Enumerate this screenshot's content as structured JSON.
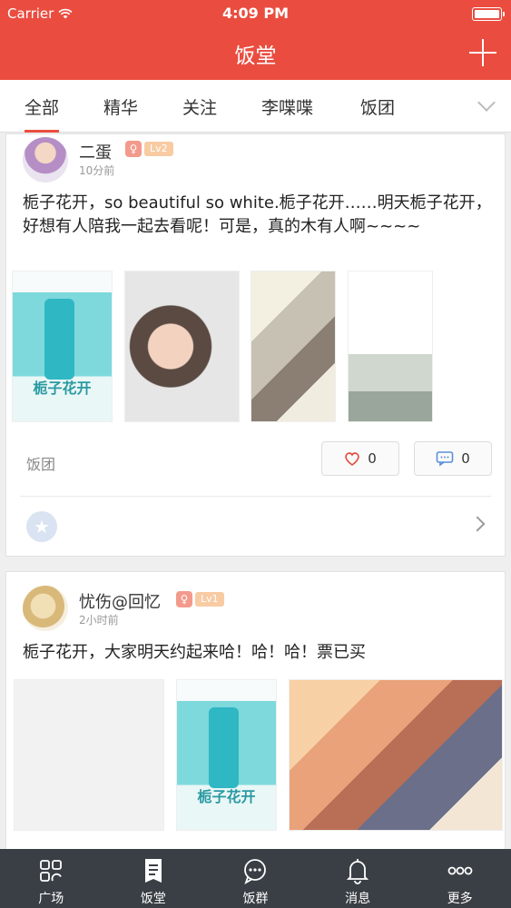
{
  "status_bar": {
    "carrier": "Carrier",
    "time": "4:09 PM"
  },
  "nav": {
    "title": "饭堂"
  },
  "tabs": [
    {
      "label": "全部",
      "active": true
    },
    {
      "label": "精华"
    },
    {
      "label": "关注"
    },
    {
      "label": "李喋喋"
    },
    {
      "label": "饭团"
    }
  ],
  "posts": [
    {
      "username": "二蛋",
      "level": "Lv2",
      "time_ago": "10分前",
      "text": "栀子花开，so beautiful so white.栀子花开……明天栀子花开，好想有人陪我一起去看呢！可是，真的木有人啊~~~~",
      "images": [
        "poster",
        "boy",
        "couple-1",
        "couple-2"
      ],
      "group": "饭团",
      "like_count": "0",
      "comment_count": "0"
    },
    {
      "username": "忧伤@回忆",
      "level": "Lv1",
      "time_ago": "2小时前",
      "text": "栀子花开，大家明天约起来哈！哈！哈！票已买",
      "images": [
        "blank",
        "poster",
        "romance"
      ]
    }
  ],
  "tabbar": [
    {
      "label": "广场",
      "icon": "grid-icon"
    },
    {
      "label": "饭堂",
      "icon": "document-icon",
      "active": true
    },
    {
      "label": "饭群",
      "icon": "chat-bubble-icon"
    },
    {
      "label": "消息",
      "icon": "bell-icon"
    },
    {
      "label": "更多",
      "icon": "more-dots-icon"
    }
  ],
  "colors": {
    "brand": "#ea4d40",
    "tabbar_bg": "#3a3f45"
  }
}
